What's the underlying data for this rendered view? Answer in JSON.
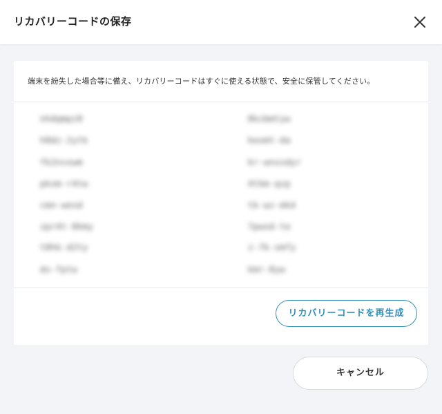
{
  "dialog": {
    "title": "リカバリーコードの保存",
    "close_icon": "close-icon"
  },
  "card": {
    "note": "端末を紛失した場合等に備え、リカバリーコードはすぐに使える状態で、安全に保管してください。",
    "codes_left": [
      "nhdqmpz8",
      "h8dz-2ytk",
      "fk2nvxwm",
      "pkxm-r4tw",
      "cmn-wexd",
      "zpr4t-8kmy",
      "t8hk-d2ty",
      "dx-fptw"
    ],
    "codes_right": [
      "8kzbmtyw",
      "kexmt-da",
      "kr-wnxsdyr",
      "4tkm-qzp",
      "tk-wz-mk4",
      "7pwxd-te",
      "z-7k-xmfy",
      "kmr-8yw"
    ],
    "regenerate_label": "リカバリーコードを再生成"
  },
  "footer": {
    "cancel_label": "キャンセル"
  },
  "colors": {
    "accent": "#2f8fb8",
    "background": "#f2f4f7"
  }
}
